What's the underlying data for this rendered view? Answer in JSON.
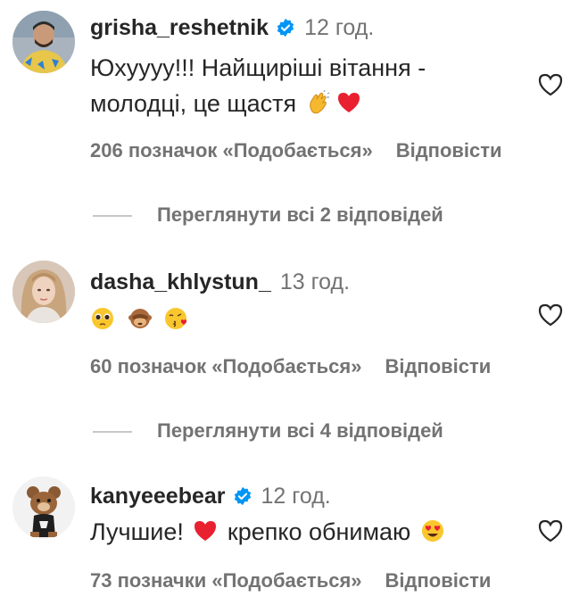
{
  "comments": [
    {
      "username": "grisha_reshetnik",
      "verified": true,
      "time": "12 год.",
      "text_line1": "Юхуууу!!! Найщиріші вітання -",
      "text_line2": "молодці, це щастя",
      "emojis": [
        "clap-emoji",
        "red-heart-emoji"
      ],
      "likes": "206 позначок «Подобається»",
      "reply_label": "Відповісти",
      "view_replies": "Переглянути всі 2 відповідей"
    },
    {
      "username": "dasha_khlystun_",
      "verified": false,
      "time": "13 год.",
      "emojis": [
        "pleading-face-emoji",
        "see-no-evil-monkey-emoji",
        "face-blowing-kiss-emoji"
      ],
      "likes": "60 позначок «Подобається»",
      "reply_label": "Відповісти",
      "view_replies": "Переглянути всі 4 відповідей"
    },
    {
      "username": "kanyeeebear",
      "verified": true,
      "time": "12 год.",
      "text_before": "Лучшие!",
      "text_after": "крепко обнимаю",
      "emojis": [
        "red-heart-emoji",
        "smiling-face-heart-eyes-emoji"
      ],
      "likes": "73 позначки «Подобається»",
      "reply_label": "Відповісти"
    }
  ],
  "colors": {
    "text": "#262626",
    "secondary": "#737373",
    "verified": "#0095f6",
    "heart": "#ed2a3f"
  }
}
